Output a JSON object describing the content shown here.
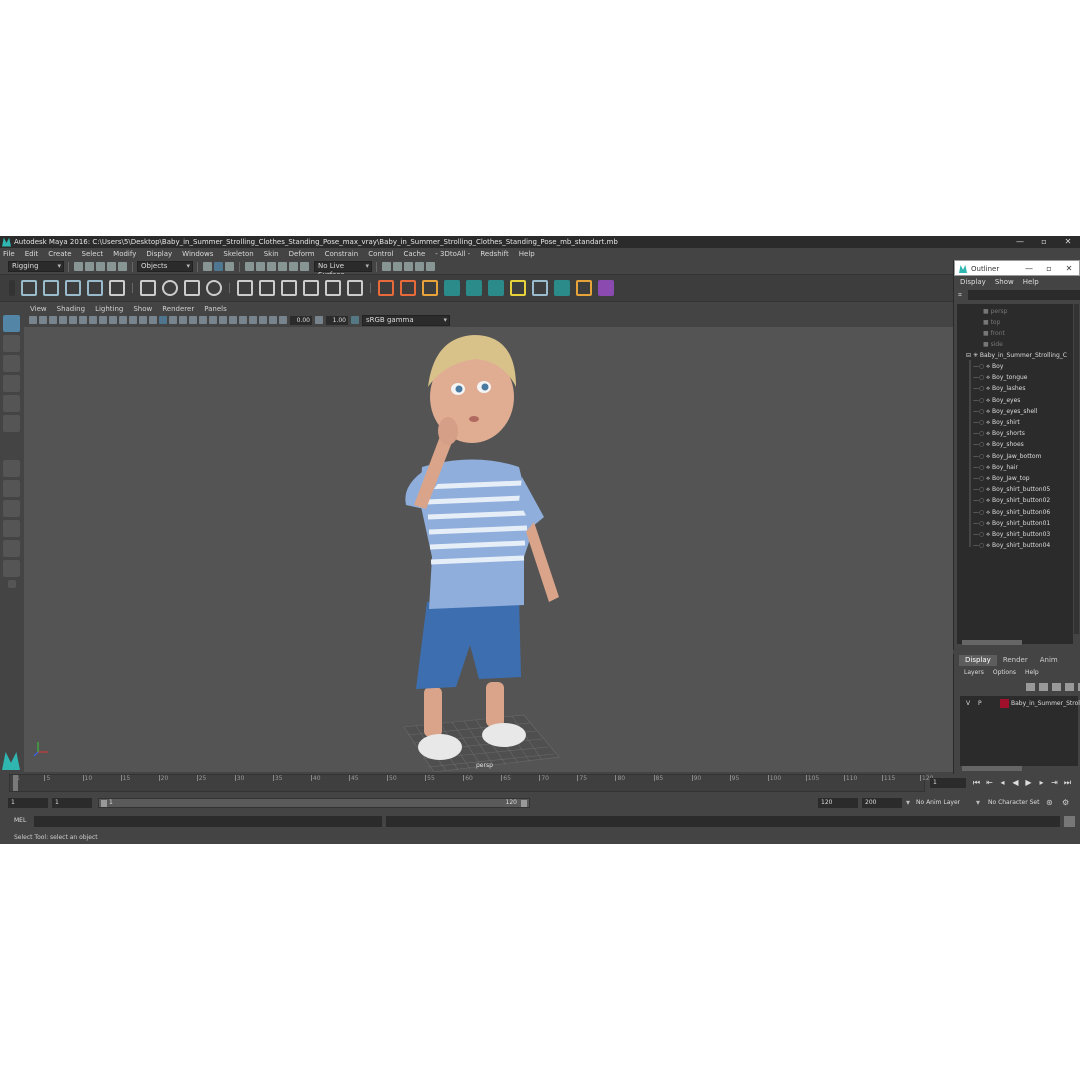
{
  "window": {
    "title": "Autodesk Maya 2016: C:\\Users\\5\\Desktop\\Baby_in_Summer_Strolling_Clothes_Standing_Pose_max_vray\\Baby_in_Summer_Strolling_Clothes_Standing_Pose_mb_standart.mb",
    "minimize": "—",
    "restore": "▫",
    "close": "✕"
  },
  "menubar": {
    "items": [
      "File",
      "Edit",
      "Create",
      "Select",
      "Modify",
      "Display",
      "Windows",
      "Skeleton",
      "Skin",
      "Deform",
      "Constrain",
      "Control",
      "Cache",
      "- 3DtoAll -",
      "Redshift",
      "Help"
    ]
  },
  "statusline": {
    "menuset": "Rigging",
    "selection_mode": "Objects",
    "live_surface": "No Live Surface"
  },
  "panel": {
    "menus": [
      "View",
      "Shading",
      "Lighting",
      "Show",
      "Renderer",
      "Panels"
    ],
    "exposure": "0.00",
    "gamma": "1.00",
    "color_space": "sRGB gamma",
    "camera": "persp"
  },
  "timeslider": {
    "ticks": [
      "1",
      "5",
      "10",
      "15",
      "20",
      "25",
      "30",
      "35",
      "40",
      "45",
      "50",
      "55",
      "60",
      "65",
      "70",
      "75",
      "80",
      "85",
      "90",
      "95",
      "100",
      "105",
      "110",
      "115",
      "120"
    ],
    "current_frame": "1"
  },
  "range": {
    "start": "1",
    "anim_start": "1",
    "slider_start": "1",
    "slider_end": "120",
    "anim_end": "120",
    "end": "200",
    "anim_layer": "No Anim Layer",
    "character_set": "No Character Set"
  },
  "cmdline": {
    "lang": "MEL"
  },
  "helpline": {
    "text": "Select Tool: select an object"
  },
  "outliner": {
    "title": "Outliner",
    "menus": [
      "Display",
      "Show",
      "Help"
    ],
    "cameras": [
      "persp",
      "top",
      "front",
      "side"
    ],
    "group": "Baby_in_Summer_Strolling_C",
    "children": [
      "Boy",
      "Boy_tongue",
      "Boy_lashes",
      "Boy_eyes",
      "Boy_eyes_shell",
      "Boy_shirt",
      "Boy_shorts",
      "Boy_shoes",
      "Boy_Jaw_bottom",
      "Boy_hair",
      "Boy_Jaw_top",
      "Boy_shirt_button05",
      "Boy_shirt_button02",
      "Boy_shirt_button06",
      "Boy_shirt_button01",
      "Boy_shirt_button03",
      "Boy_shirt_button04"
    ]
  },
  "layers": {
    "tabs": [
      "Display",
      "Render",
      "Anim"
    ],
    "menus": [
      "Layers",
      "Options",
      "Help"
    ],
    "row": {
      "visible": "V",
      "playback": "P",
      "name": "Baby_in_Summer_Stroll",
      "color": "#a0102a"
    }
  },
  "colors": {
    "accent": "#5285a6",
    "maya_logo": "#2fb6b0"
  }
}
